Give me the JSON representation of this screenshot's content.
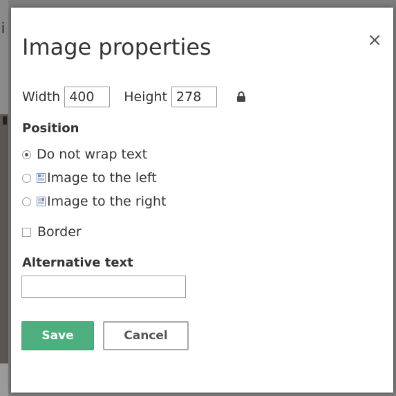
{
  "dialog": {
    "title": "Image properties",
    "close_label": "×"
  },
  "size": {
    "width_label": "Width",
    "width_value": "400",
    "height_label": "Height",
    "height_value": "278",
    "lock_icon": "lock-icon"
  },
  "position": {
    "heading": "Position",
    "options": [
      {
        "label": "Do not wrap text",
        "checked": true
      },
      {
        "label": "Image to the left",
        "icon": "wrap-left-icon",
        "checked": false
      },
      {
        "label": "Image to the right",
        "icon": "wrap-right-icon",
        "checked": false
      }
    ]
  },
  "border": {
    "label": "Border",
    "checked": false
  },
  "alt_text": {
    "heading": "Alternative text",
    "value": ""
  },
  "buttons": {
    "save_label": "Save",
    "cancel_label": "Cancel"
  },
  "colors": {
    "save_bg": "#4caf7d",
    "text": "#333333"
  },
  "background": {
    "glyph": "i"
  }
}
